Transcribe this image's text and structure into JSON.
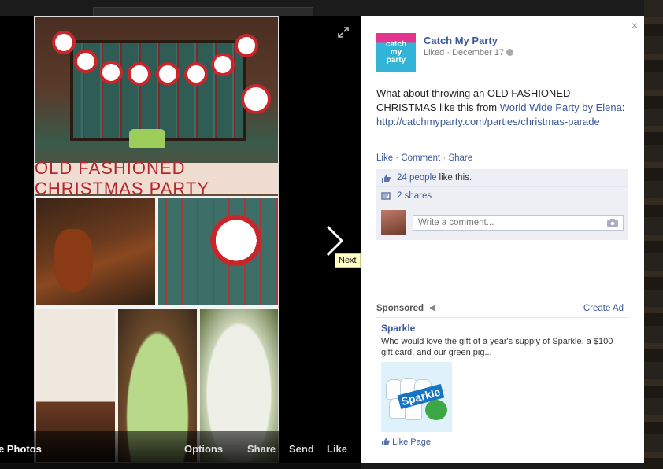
{
  "colors": {
    "link": "#3b5998",
    "tooltip_bg": "#ffffc6",
    "banner_red": "#b4262b",
    "ufi_bg": "#edeff4"
  },
  "photo": {
    "banner_text": "OLD FASHIONED CHRISTMAS PARTY",
    "next_tooltip": "Next",
    "bar": {
      "left_label": "e Photos",
      "options": "Options",
      "share": "Share",
      "send": "Send",
      "like": "Like"
    }
  },
  "panel": {
    "close": "×",
    "page_logo_lines": [
      "catch",
      "my",
      "party"
    ],
    "page_name": "Catch My Party",
    "meta": "Liked · December 17",
    "post": {
      "line1": "What about throwing an OLD FASHIONED",
      "line2_prefix": "CHRISTMAS like this from ",
      "link_name": "World Wide Party by Elena",
      "url": "http://catchmyparty.com/parties/christmas-parade"
    },
    "actions": {
      "like": "Like",
      "comment": "Comment",
      "share": "Share",
      "separator": " · "
    },
    "likes": {
      "count_link": "24 people",
      "suffix": "like this."
    },
    "shares": {
      "link": "2 shares"
    },
    "comment_placeholder": "Write a comment..."
  },
  "sponsored": {
    "label": "Sponsored",
    "create_ad": "Create Ad",
    "ad": {
      "title": "Sparkle",
      "body": "Who would love the gift of a year's supply of Sparkle, a $100 gift card, and our green pig...",
      "image_brand": "Sparkle",
      "like_page": "Like Page"
    }
  }
}
